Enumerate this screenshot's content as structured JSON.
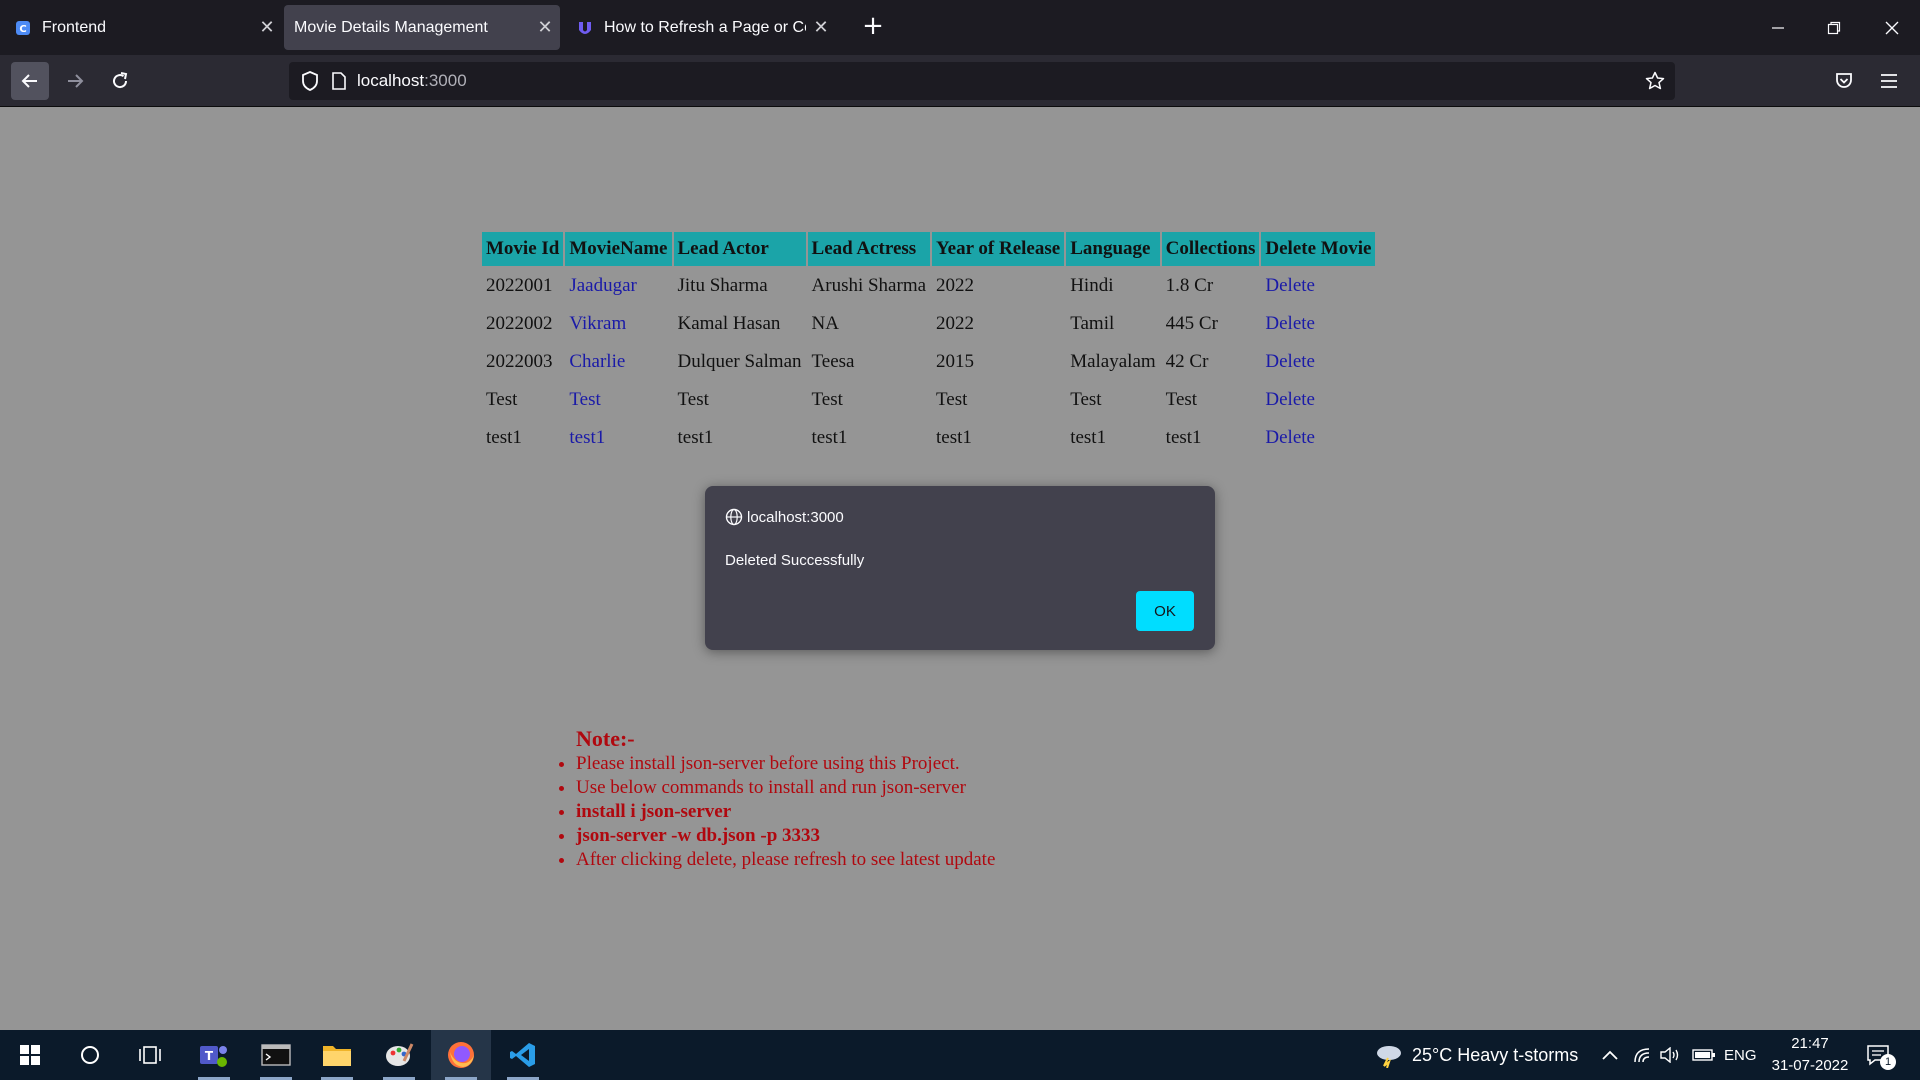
{
  "browser": {
    "tabs": [
      {
        "label": "Frontend",
        "active": false
      },
      {
        "label": "Movie Details Management",
        "active": true
      },
      {
        "label": "How to Refresh a Page or Comp",
        "active": false
      }
    ],
    "url_host": "localhost",
    "url_port": ":3000"
  },
  "table": {
    "headers": [
      "Movie Id",
      "MovieName",
      "Lead Actor",
      "Lead Actress",
      "Year of Release",
      "Language",
      "Collections",
      "Delete Movie"
    ],
    "rows": [
      [
        "2022001",
        "Jaadugar",
        "Jitu Sharma",
        "Arushi Sharma",
        "2022",
        "Hindi",
        "1.8 Cr",
        "Delete"
      ],
      [
        "2022002",
        "Vikram",
        "Kamal Hasan",
        "NA",
        "2022",
        "Tamil",
        "445 Cr",
        "Delete"
      ],
      [
        "2022003",
        "Charlie",
        "Dulquer Salman",
        "Teesa",
        "2015",
        "Malayalam",
        "42 Cr",
        "Delete"
      ],
      [
        "Test",
        "Test",
        "Test",
        "Test",
        "Test",
        "Test",
        "Test",
        "Delete"
      ],
      [
        "test1",
        "test1",
        "test1",
        "test1",
        "test1",
        "test1",
        "test1",
        "Delete"
      ]
    ]
  },
  "note": {
    "heading": "Note:-",
    "items": [
      {
        "text": "Please install json-server before using this Project.",
        "bold": false
      },
      {
        "text": "Use below commands to install and run json-server",
        "bold": false
      },
      {
        "text": "install i json-server",
        "bold": true
      },
      {
        "text": "json-server -w db.json -p 3333",
        "bold": true
      },
      {
        "text": "After clicking delete, please refresh to see latest update",
        "bold": false
      }
    ]
  },
  "dialog": {
    "origin": "localhost:3000",
    "message": "Deleted Successfully",
    "ok_label": "OK"
  },
  "taskbar": {
    "weather": "25°C  Heavy t-storms",
    "language": "ENG",
    "time": "21:47",
    "date": "31-07-2022",
    "notification_count": "1"
  },
  "colors": {
    "header_bg": "#1ba4a8",
    "link": "#1a1aa8",
    "note": "#b0080f",
    "ok_button": "#00ddff"
  }
}
